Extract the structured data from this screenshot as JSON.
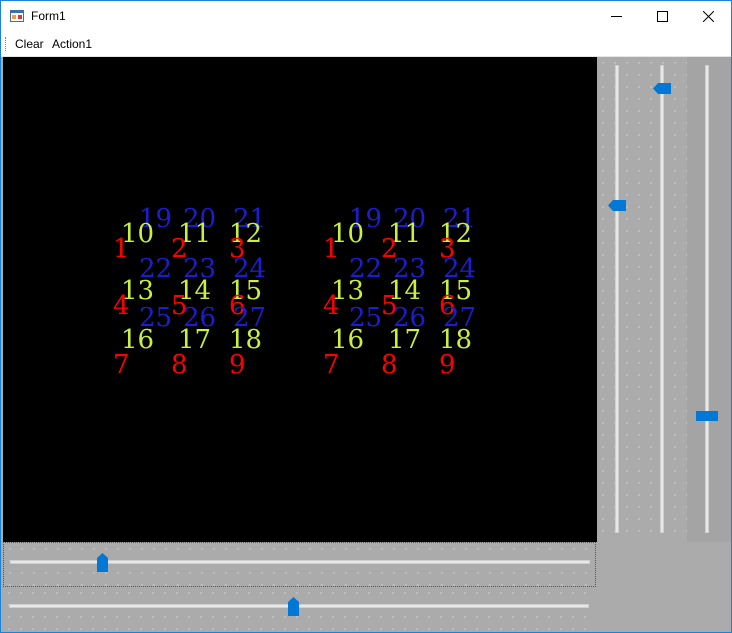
{
  "window": {
    "title": "Form1"
  },
  "titlebar_buttons": {
    "minimize": "—",
    "maximize": "☐",
    "close": "✕"
  },
  "menu": {
    "items": [
      "Clear",
      "Action1"
    ]
  },
  "colors": {
    "red": "#ff0000",
    "green": "#c8f03c",
    "blue": "#1d1dcf",
    "accent": "#0078d7"
  },
  "canvas": {
    "background": "#000000",
    "number_sets": 2,
    "red_numbers": [
      "1",
      "2",
      "3",
      "4",
      "5",
      "6",
      "7",
      "8",
      "9"
    ],
    "green_numbers": [
      "10",
      "11",
      "12",
      "13",
      "14",
      "15",
      "16",
      "17",
      "18"
    ],
    "blue_numbers": [
      "19",
      "20",
      "21",
      "22",
      "23",
      "24",
      "25",
      "26",
      "27"
    ]
  },
  "sliders": {
    "vertical_left_level": 0.7,
    "vertical_mid_level": 0.95,
    "vertical_right_level": 0.25,
    "horizontal_top_level": 0.16,
    "horizontal_bottom_level": 0.49
  }
}
